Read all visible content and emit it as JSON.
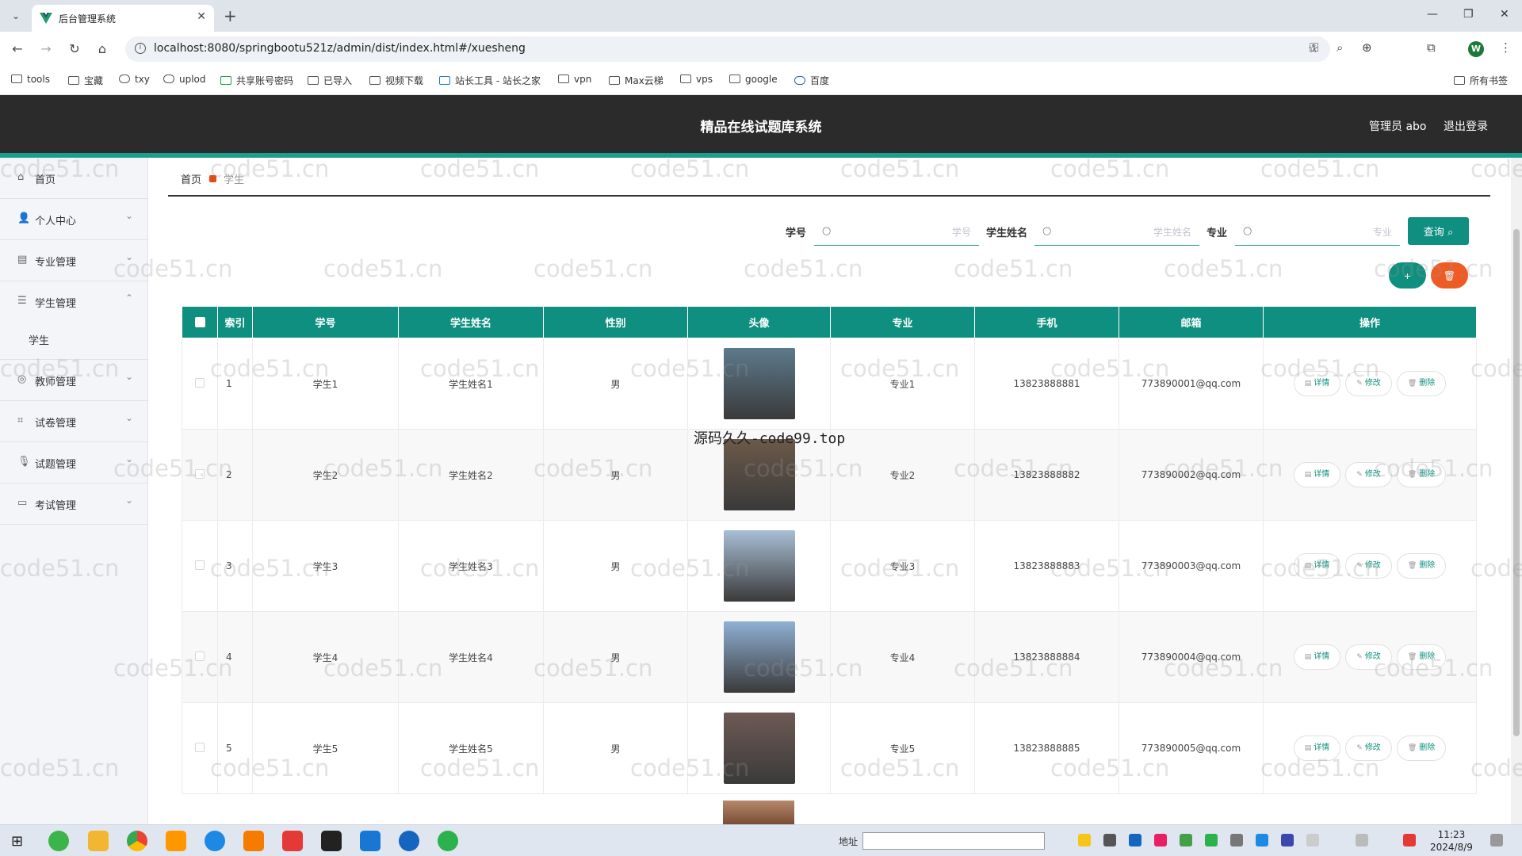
{
  "browser": {
    "tab_title": "后台管理系统",
    "url": "localhost:8080/springbootu521z/admin/dist/index.html#/xuesheng",
    "bookmarks": [
      "tools",
      "宝藏",
      "txy",
      "uplod",
      "共享账号密码",
      "已导入",
      "视频下载",
      "站长工具 - 站长之家",
      "vpn",
      "Max云梯",
      "vps",
      "google",
      "百度",
      "所有书签"
    ],
    "profile_initial": "W"
  },
  "header": {
    "title": "精品在线试题库系统",
    "user": "管理员 abo",
    "logout": "退出登录"
  },
  "sidebar": {
    "items": [
      {
        "label": "首页",
        "icon": "home-icon"
      },
      {
        "label": "个人中心",
        "icon": "user-icon"
      },
      {
        "label": "专业管理",
        "icon": "book-icon"
      },
      {
        "label": "学生管理",
        "icon": "list-icon"
      },
      {
        "label": "教师管理",
        "icon": "circle-icon"
      },
      {
        "label": "试卷管理",
        "icon": "crop-icon"
      },
      {
        "label": "试题管理",
        "icon": "mic-icon"
      },
      {
        "label": "考试管理",
        "icon": "chat-icon"
      }
    ],
    "submenu": {
      "label": "学生"
    }
  },
  "breadcrumb": {
    "home": "首页",
    "current": "学生"
  },
  "search": {
    "fields": [
      {
        "label": "学号",
        "placeholder": "学号"
      },
      {
        "label": "学生姓名",
        "placeholder": "学生姓名"
      },
      {
        "label": "专业",
        "placeholder": "专业"
      }
    ],
    "query_label": "查询",
    "add_label": "+",
    "delete_label": "🗑"
  },
  "table": {
    "columns": [
      "索引",
      "学号",
      "学生姓名",
      "性别",
      "头像",
      "专业",
      "手机",
      "邮箱",
      "操作"
    ],
    "rows": [
      {
        "index": "1",
        "xuehao": "学生1",
        "name": "学生姓名1",
        "gender": "男",
        "major": "专业1",
        "phone": "13823888881",
        "email": "773890001@qq.com",
        "avatar_color": "#5d7a8c"
      },
      {
        "index": "2",
        "xuehao": "学生2",
        "name": "学生姓名2",
        "gender": "男",
        "major": "专业2",
        "phone": "13823888882",
        "email": "773890002@qq.com",
        "avatar_color": "#6b5a4a"
      },
      {
        "index": "3",
        "xuehao": "学生3",
        "name": "学生姓名3",
        "gender": "男",
        "major": "专业3",
        "phone": "13823888883",
        "email": "773890003@qq.com",
        "avatar_color": "#a9bfd6"
      },
      {
        "index": "4",
        "xuehao": "学生4",
        "name": "学生姓名4",
        "gender": "男",
        "major": "专业4",
        "phone": "13823888884",
        "email": "773890004@qq.com",
        "avatar_color": "#8fb0d4"
      },
      {
        "index": "5",
        "xuehao": "学生5",
        "name": "学生姓名5",
        "gender": "男",
        "major": "专业5",
        "phone": "13823888885",
        "email": "773890005@qq.com",
        "avatar_color": "#6e5a55"
      }
    ],
    "actions": {
      "detail": "详情",
      "edit": "修改",
      "delete": "删除"
    }
  },
  "watermark": "code51.cn",
  "overlay_text": "源码久久-code99.top",
  "taskbar": {
    "address_label": "地址",
    "time": "11:23",
    "date": "2024/8/9"
  },
  "colors": {
    "primary": "#0f8f7f",
    "danger": "#ef5b25",
    "header_bg": "#2b2b2b",
    "accent_line": "#1a9e8d"
  }
}
